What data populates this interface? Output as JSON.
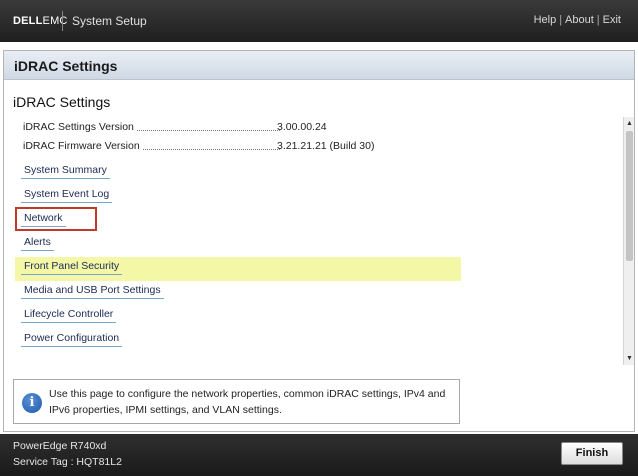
{
  "header": {
    "brand_dell": "DELL",
    "brand_emc": "EMC",
    "app_title": "System Setup",
    "links": [
      "Help",
      "About",
      "Exit"
    ]
  },
  "page": {
    "header_title": "iDRAC Settings",
    "section_title": "iDRAC Settings"
  },
  "info": [
    {
      "label": "iDRAC Settings Version",
      "value": "3.00.00.24"
    },
    {
      "label": "iDRAC Firmware Version",
      "value": "3.21.21.21 (Build 30)"
    }
  ],
  "menu": [
    "System Summary",
    "System Event Log",
    "Network",
    "Alerts",
    "Front Panel Security",
    "Media and USB Port Settings",
    "Lifecycle Controller",
    "Power Configuration"
  ],
  "selected_menu_item": "Network",
  "help": {
    "icon": "info-icon",
    "text": "Use this page to configure the network properties, common iDRAC settings, IPv4 and IPv6 properties, IPMI settings, and VLAN settings."
  },
  "footer": {
    "model": "PowerEdge R740xd",
    "service_tag": "Service Tag : HQT81L2",
    "finish_label": "Finish"
  },
  "colors": {
    "highlight": "#f4f7a6",
    "selection_border": "#c0392b",
    "link_underline": "#7aa6c9"
  }
}
